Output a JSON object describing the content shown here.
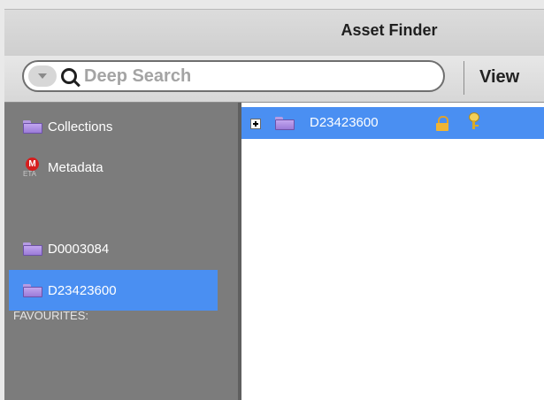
{
  "window": {
    "title": "Asset Finder"
  },
  "toolbar": {
    "search_placeholder": "Deep Search",
    "view_label": "View"
  },
  "sidebar": {
    "items": [
      {
        "label": "Collections",
        "icon": "folder-icon"
      },
      {
        "label": "Metadata",
        "icon": "metadata-icon"
      }
    ],
    "favourites_header": "FAVOURITES:",
    "favourites": [
      {
        "label": "D0003084",
        "icon": "folder-icon",
        "selected": false
      },
      {
        "label": "D23423600",
        "icon": "folder-icon",
        "selected": true
      }
    ]
  },
  "content": {
    "rows": [
      {
        "label": "D23423600",
        "expanded": false,
        "locked": true,
        "has_key": true,
        "selected": true
      }
    ]
  },
  "colors": {
    "selection": "#4a8ff2",
    "sidebar_bg": "#7c7c7c"
  }
}
